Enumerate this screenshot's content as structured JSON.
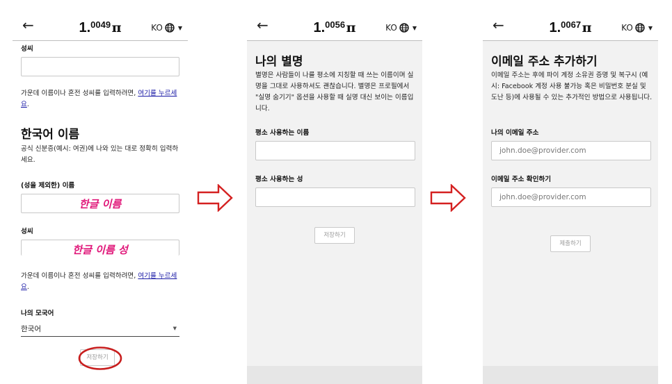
{
  "screens": [
    {
      "balance_whole": "1.",
      "balance_decimals": "0049",
      "pi": "π",
      "lang_code": "KO",
      "top_label": "성씨",
      "middle_name_hint": "가운데 이름이나 혼전 성씨를 입력하려면, ",
      "middle_name_link": "여기를 누르세요",
      "middle_name_end": ".",
      "section_title": "한국어 이름",
      "section_desc": "공식 신분증(예시: 여권)에 나와 있는 대로 정확히 입력하세요.",
      "first_name_label": "(성을 제외한) 이름",
      "first_name_value": "한글 이름",
      "last_name_label": "성씨",
      "last_name_value": "한글 이름 성",
      "middle_name_hint2": "가운데 이름이나 혼전 성씨를 입력하려면, ",
      "middle_name_link2": "여기를 누르세요",
      "middle_name_end2": ".",
      "native_lang_label": "나의 모국어",
      "native_lang_value": "한국어",
      "save_label": "저장하기"
    },
    {
      "balance_whole": "1.",
      "balance_decimals": "0056",
      "pi": "π",
      "lang_code": "KO",
      "title": "나의 별명",
      "desc": "별명은 사람들이 나를 평소에 지칭할 때 쓰는 이름이며 실명을 그대로 사용하셔도 괜찮습니다. 별명은 프로필에서 \"실명 숨기기\" 옵션을 사용할 때 실명 대신 보이는 이름입니다.",
      "first_label": "평소 사용하는 이름",
      "last_label": "평소 사용하는 성",
      "save_label": "저장하기"
    },
    {
      "balance_whole": "1.",
      "balance_decimals": "0067",
      "pi": "π",
      "lang_code": "KO",
      "title": "이메일 주소 추가하기",
      "desc": "이메일 주소는 후에 파이 계정 소유권 증명 및 복구시 (예시: Facebook 계정 사용 불가능 혹은 비밀번호 분실 및 도난 등)에 사용될 수 있는 추가적인 방법으로 사용됩니다.",
      "email_label": "나의 이메일 주소",
      "email_placeholder": "john.doe@provider.com",
      "confirm_label": "이메일 주소 확인하기",
      "confirm_placeholder": "john.doe@provider.com",
      "submit_label": "제출하기"
    }
  ],
  "colors": {
    "highlight": "#e0187a",
    "arrow": "#d42020",
    "circle": "#c81e1e",
    "link": "#1a1aa6"
  }
}
